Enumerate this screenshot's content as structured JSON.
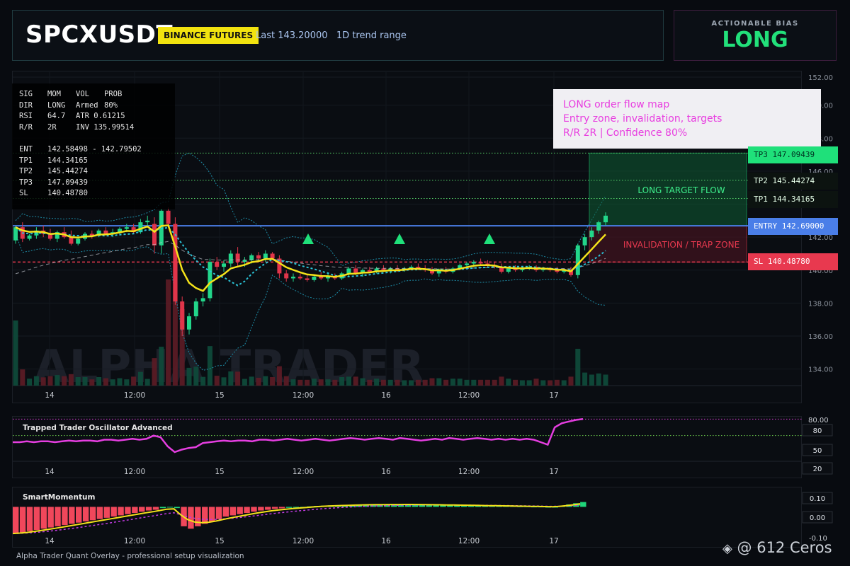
{
  "header": {
    "symbol": "SPCXUSDT",
    "exchange": "BINANCE FUTURES",
    "last": "Last 143.20000   1D trend range"
  },
  "bias": {
    "label": "ACTIONABLE BIAS",
    "value": "LONG"
  },
  "infobox": {
    "rows": [
      [
        "SIG",
        "MOM",
        "VOL",
        "PROB"
      ],
      [
        "DIR",
        "LONG",
        "Armed",
        "80%"
      ],
      [
        "RSI",
        "64.7",
        "ATR 0.61215",
        ""
      ],
      [
        "R/R",
        "2R",
        "INV 135.99514",
        ""
      ],
      [
        "",
        "",
        "",
        ""
      ],
      [
        "ENT",
        "142.58498 - 142.79502",
        "",
        ""
      ],
      [
        "TP1",
        "144.34165",
        "",
        ""
      ],
      [
        "TP2",
        "145.44274",
        "",
        ""
      ],
      [
        "TP3",
        "147.09439",
        "",
        ""
      ],
      [
        "SL",
        "140.48780",
        "",
        ""
      ]
    ]
  },
  "annotation": {
    "line1": "LONG order flow map",
    "line2": "Entry zone, invalidation, targets",
    "line3": "R/R 2R | Confidence 80%"
  },
  "zones": {
    "target_label": "LONG TARGET FLOW",
    "invalid_label": "INVALIDATION / TRAP ZONE"
  },
  "tags": {
    "tp3": "TP3 147.09439",
    "tp2": "TP2 145.44274",
    "tp1": "TP1 144.34165",
    "entry": "ENTRY 142.69000",
    "sl": "SL 140.48780"
  },
  "watermark_text": "ALPHA TRADER",
  "footer": "Alpha Trader Quant Overlay - professional setup visualization",
  "credit": "@ 612 Ceros",
  "colors": {
    "bull": "#22d68a",
    "bear": "#e0354a",
    "ema": "#f4e21a",
    "osc": "#e53ee0",
    "entry": "#4a7ee8",
    "tag_green": "#1fe07a",
    "tag_red": "#e8394f"
  },
  "chart_data": [
    {
      "type": "candlestick",
      "title": "",
      "ylim": [
        133,
        152
      ],
      "y_ticks": [
        "152.00",
        "150.00",
        "148.00",
        "146.00",
        "144.00",
        "142.00",
        "140.00",
        "138.00",
        "136.00",
        "134.00"
      ],
      "x_ticks": [
        "14",
        "12:00",
        "15",
        "12:00",
        "16",
        "12:00",
        "17"
      ],
      "levels": {
        "tp3": 147.09439,
        "tp2": 145.44274,
        "tp1": 144.34165,
        "entry": 142.69,
        "sl": 140.4878
      },
      "ohlc": [
        [
          141.8,
          142.7,
          141.6,
          142.6
        ],
        [
          142.6,
          142.9,
          141.7,
          141.9
        ],
        [
          141.9,
          142.2,
          141.8,
          142.1
        ],
        [
          142.1,
          142.6,
          141.9,
          142.4
        ],
        [
          142.4,
          142.7,
          142.0,
          142.2
        ],
        [
          142.2,
          142.5,
          141.8,
          141.9
        ],
        [
          141.9,
          142.4,
          141.7,
          142.3
        ],
        [
          142.3,
          142.6,
          141.9,
          142.0
        ],
        [
          142.0,
          142.4,
          141.5,
          141.6
        ],
        [
          141.6,
          142.0,
          141.5,
          141.9
        ],
        [
          141.9,
          142.3,
          141.8,
          142.2
        ],
        [
          142.2,
          142.4,
          141.9,
          142.1
        ],
        [
          142.1,
          142.5,
          142.0,
          142.4
        ],
        [
          142.4,
          142.6,
          142.1,
          142.2
        ],
        [
          142.2,
          142.5,
          142.0,
          142.3
        ],
        [
          142.3,
          142.6,
          142.1,
          142.5
        ],
        [
          142.5,
          142.8,
          142.3,
          142.6
        ],
        [
          142.6,
          142.8,
          142.2,
          142.3
        ],
        [
          142.3,
          143.1,
          142.2,
          142.9
        ],
        [
          142.9,
          143.3,
          142.7,
          143.0
        ],
        [
          142.8,
          143.2,
          141.0,
          141.5
        ],
        [
          141.5,
          143.7,
          141.0,
          143.6
        ],
        [
          143.6,
          143.8,
          142.7,
          142.8
        ],
        [
          142.8,
          143.2,
          137.9,
          138.1
        ],
        [
          138.1,
          138.4,
          136.0,
          136.4
        ],
        [
          136.4,
          137.4,
          136.1,
          137.2
        ],
        [
          137.2,
          138.3,
          137.0,
          138.1
        ],
        [
          138.1,
          138.6,
          137.8,
          138.3
        ],
        [
          138.3,
          140.7,
          138.1,
          140.5
        ],
        [
          140.5,
          140.8,
          140.0,
          140.2
        ],
        [
          140.2,
          140.6,
          139.9,
          140.4
        ],
        [
          140.4,
          141.2,
          140.2,
          141.0
        ],
        [
          141.0,
          141.4,
          140.2,
          140.5
        ],
        [
          140.5,
          140.8,
          140.2,
          140.6
        ],
        [
          140.6,
          141.0,
          140.4,
          140.9
        ],
        [
          140.9,
          141.1,
          140.5,
          140.7
        ],
        [
          140.7,
          141.2,
          140.5,
          141.0
        ],
        [
          141.0,
          141.1,
          140.6,
          140.7
        ],
        [
          140.7,
          140.9,
          139.5,
          139.8
        ],
        [
          139.8,
          140.0,
          139.3,
          139.5
        ],
        [
          139.5,
          139.8,
          139.3,
          139.6
        ],
        [
          139.6,
          139.8,
          139.4,
          139.5
        ],
        [
          139.5,
          139.7,
          139.3,
          139.4
        ],
        [
          139.4,
          139.7,
          139.3,
          139.6
        ],
        [
          139.6,
          139.9,
          139.4,
          139.5
        ],
        [
          139.5,
          139.8,
          139.3,
          139.6
        ],
        [
          139.6,
          139.8,
          139.4,
          139.5
        ],
        [
          139.5,
          139.9,
          139.4,
          139.8
        ],
        [
          139.8,
          140.2,
          139.6,
          140.1
        ],
        [
          140.1,
          140.3,
          139.7,
          139.8
        ],
        [
          139.8,
          140.1,
          139.6,
          140.0
        ],
        [
          140.0,
          140.2,
          139.8,
          139.9
        ],
        [
          139.9,
          140.2,
          139.8,
          140.1
        ],
        [
          140.1,
          140.3,
          139.9,
          140.0
        ],
        [
          140.0,
          140.2,
          139.8,
          140.1
        ],
        [
          140.1,
          140.3,
          139.9,
          140.0
        ],
        [
          140.0,
          140.2,
          139.9,
          140.1
        ],
        [
          140.1,
          140.3,
          140.0,
          140.2
        ],
        [
          140.2,
          140.4,
          140.0,
          140.1
        ],
        [
          140.1,
          140.3,
          139.9,
          140.0
        ],
        [
          140.0,
          140.2,
          139.7,
          139.8
        ],
        [
          139.8,
          140.1,
          139.6,
          140.0
        ],
        [
          140.0,
          140.2,
          139.8,
          139.9
        ],
        [
          139.9,
          140.2,
          139.8,
          140.1
        ],
        [
          140.1,
          140.4,
          140.0,
          140.3
        ],
        [
          140.3,
          140.5,
          140.1,
          140.4
        ],
        [
          140.4,
          140.6,
          140.2,
          140.5
        ],
        [
          140.5,
          140.7,
          140.3,
          140.4
        ],
        [
          140.4,
          140.6,
          140.2,
          140.3
        ],
        [
          140.3,
          140.5,
          140.1,
          140.2
        ],
        [
          140.2,
          140.4,
          139.8,
          139.9
        ],
        [
          139.9,
          140.2,
          139.8,
          140.1
        ],
        [
          140.1,
          140.3,
          139.9,
          140.0
        ],
        [
          140.0,
          140.2,
          139.9,
          140.1
        ],
        [
          140.1,
          140.3,
          140.0,
          140.2
        ],
        [
          140.2,
          140.3,
          139.9,
          140.0
        ],
        [
          140.0,
          140.2,
          139.9,
          140.1
        ],
        [
          140.1,
          140.2,
          139.9,
          140.0
        ],
        [
          140.0,
          140.2,
          139.8,
          139.9
        ],
        [
          139.9,
          140.1,
          139.8,
          140.0
        ],
        [
          140.0,
          140.2,
          139.6,
          139.7
        ],
        [
          139.7,
          141.6,
          139.5,
          141.5
        ],
        [
          141.5,
          142.2,
          141.2,
          142.0
        ],
        [
          142.0,
          142.6,
          141.8,
          142.4
        ],
        [
          142.4,
          143.0,
          142.2,
          142.9
        ],
        [
          142.9,
          143.5,
          142.7,
          143.3
        ]
      ]
    },
    {
      "type": "line",
      "title": "Trapped Trader Oscillator Advanced",
      "ylim": [
        10,
        82
      ],
      "y_ticks": [
        "80.00",
        "80",
        "50",
        "20"
      ],
      "levels": [
        80,
        60
      ],
      "x_ticks": [
        "14",
        "12:00",
        "15",
        "12:00",
        "16",
        "12:00",
        "17"
      ],
      "values": [
        52,
        52,
        53,
        52,
        53,
        53,
        52,
        53,
        54,
        53,
        54,
        54,
        53,
        55,
        55,
        54,
        55,
        56,
        55,
        56,
        60,
        58,
        47,
        40,
        43,
        45,
        46,
        51,
        52,
        53,
        54,
        53,
        54,
        54,
        53,
        55,
        55,
        54,
        55,
        56,
        55,
        54,
        55,
        56,
        55,
        54,
        55,
        56,
        57,
        56,
        55,
        56,
        57,
        56,
        55,
        57,
        56,
        55,
        54,
        55,
        56,
        55,
        57,
        56,
        55,
        56,
        57,
        56,
        55,
        56,
        55,
        56,
        55,
        56,
        55,
        52,
        49,
        70,
        75,
        77,
        79,
        80
      ]
    },
    {
      "type": "bar",
      "title": "SmartMomentum",
      "ylim": [
        -0.12,
        0.12
      ],
      "y_ticks": [
        "0.10",
        "0.00",
        "-0.10"
      ],
      "x_ticks": [
        "14",
        "12:00",
        "15",
        "12:00",
        "16",
        "12:00",
        "17"
      ],
      "values": [
        -0.1,
        -0.095,
        -0.09,
        -0.085,
        -0.08,
        -0.075,
        -0.07,
        -0.065,
        -0.06,
        -0.055,
        -0.05,
        -0.045,
        -0.04,
        -0.035,
        -0.03,
        -0.025,
        -0.02,
        -0.015,
        -0.01,
        -0.005,
        -0.002,
        0.005,
        0.01,
        0.005,
        -0.07,
        -0.08,
        -0.07,
        -0.06,
        -0.05,
        -0.04,
        -0.03,
        -0.025,
        -0.02,
        -0.015,
        -0.01,
        -0.005,
        -0.002,
        0.002,
        0.004,
        0.006,
        0.008,
        0.01,
        0.012,
        0.014,
        0.015,
        0.016,
        0.017,
        0.018,
        0.018,
        0.019,
        0.02,
        0.02,
        0.02,
        0.02,
        0.02,
        0.02,
        0.02,
        0.02,
        0.019,
        0.019,
        0.018,
        0.018,
        0.017,
        0.017,
        0.016,
        0.016,
        0.015,
        0.015,
        0.014,
        0.014,
        0.013,
        0.013,
        0.012,
        0.012,
        0.011,
        0.011,
        0.01,
        0.01,
        0.015,
        0.02,
        0.025,
        0.03
      ]
    }
  ]
}
